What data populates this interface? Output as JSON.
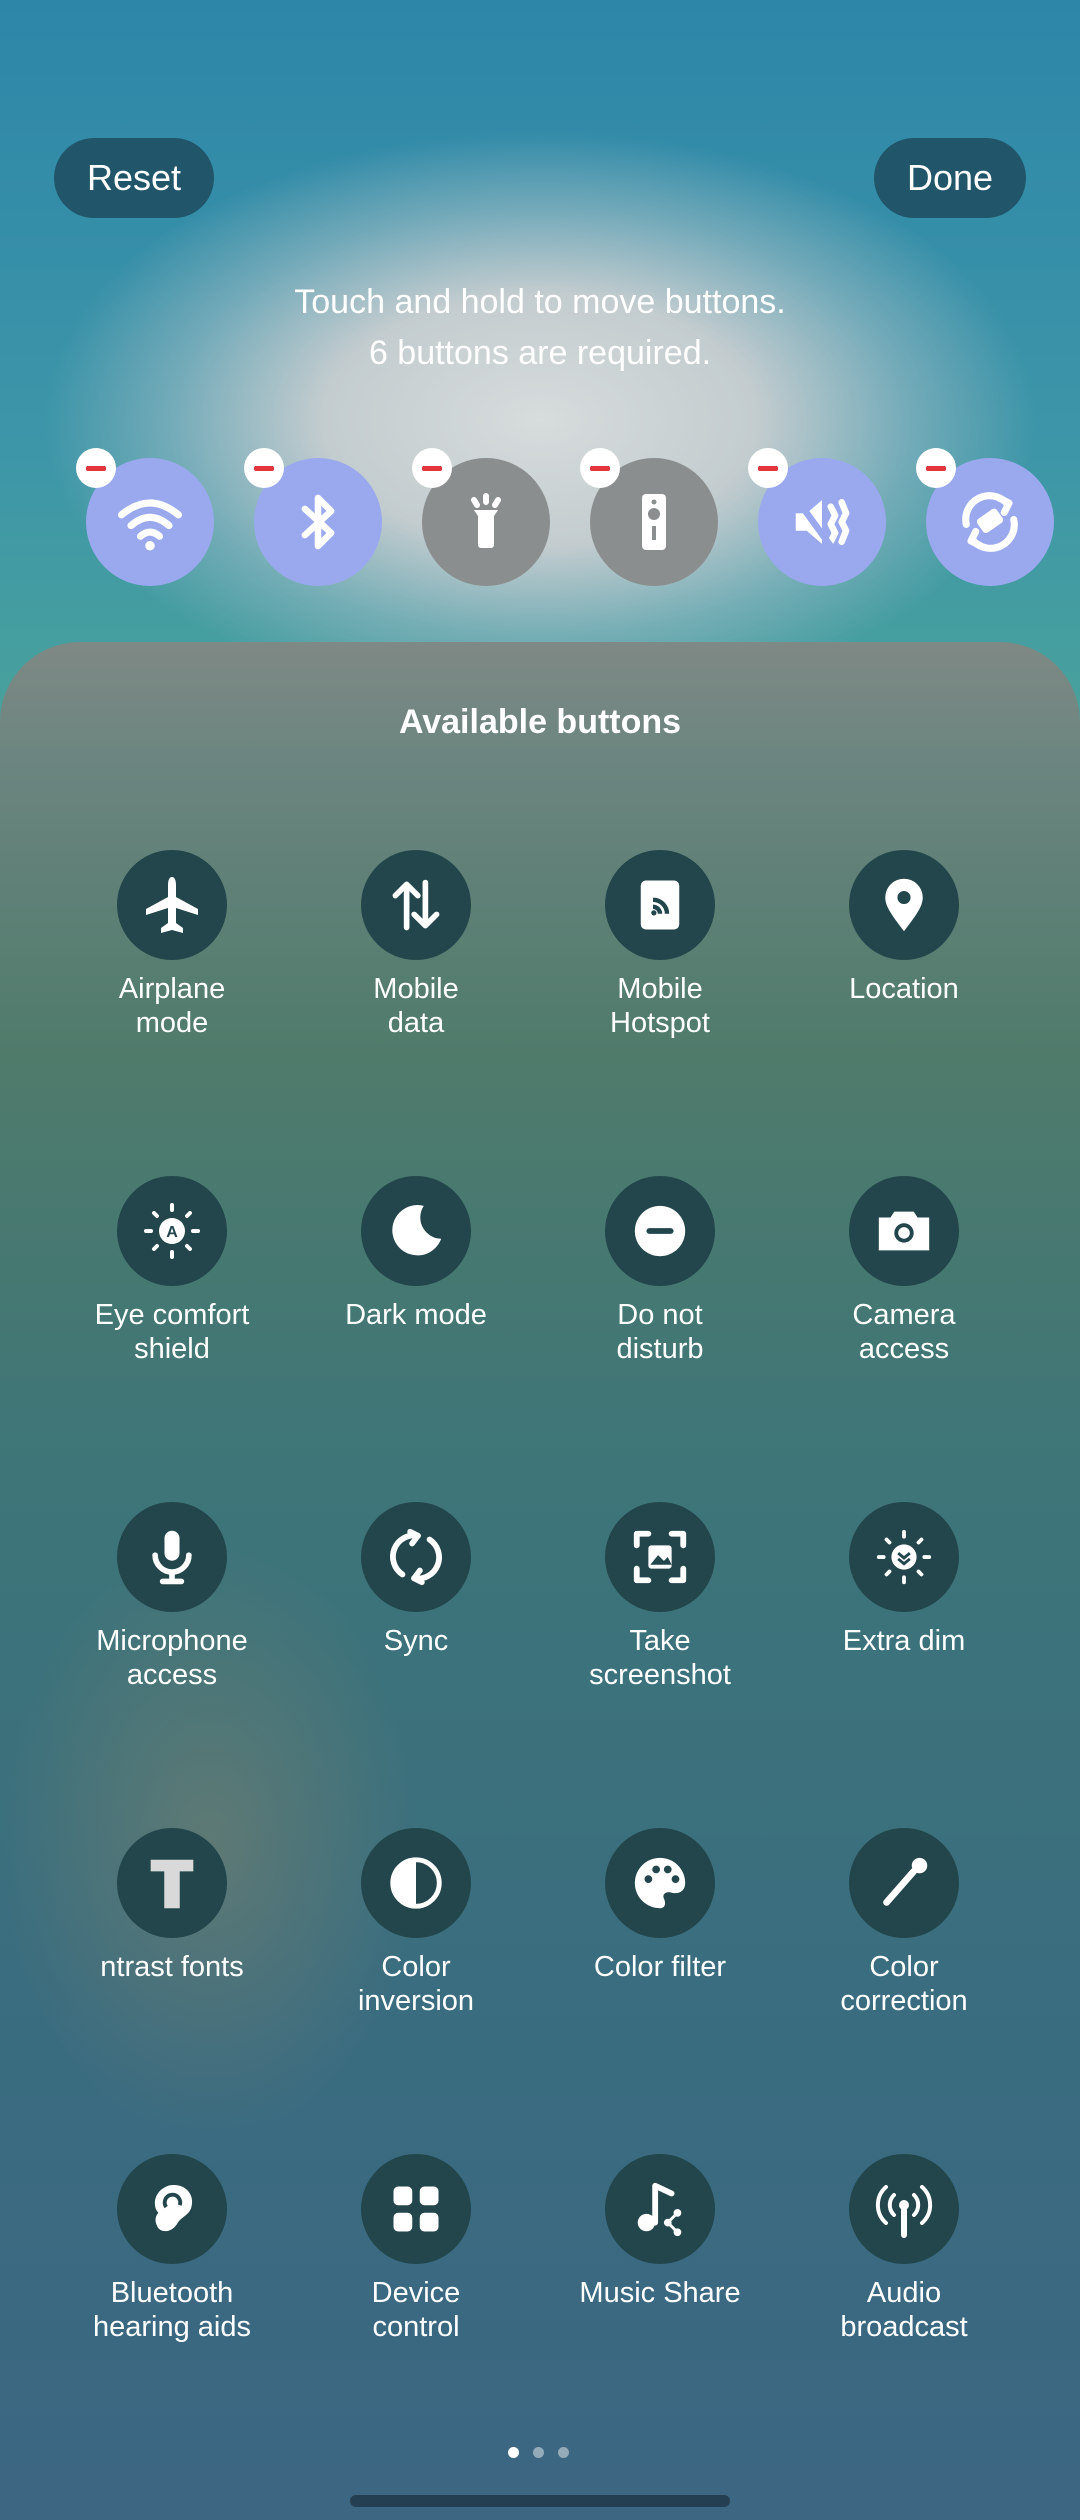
{
  "header": {
    "reset_label": "Reset",
    "done_label": "Done",
    "hint_line1": "Touch and hold to move buttons.",
    "hint_line2": "6 buttons are required."
  },
  "active_buttons": [
    {
      "icon": "wifi-icon",
      "state": "on"
    },
    {
      "icon": "bluetooth-icon",
      "state": "on"
    },
    {
      "icon": "flashlight-icon",
      "state": "off"
    },
    {
      "icon": "remote-icon",
      "state": "off"
    },
    {
      "icon": "sound-vibrate-icon",
      "state": "on"
    },
    {
      "icon": "auto-rotate-icon",
      "state": "on"
    }
  ],
  "panel": {
    "title": "Available buttons",
    "tiles": [
      {
        "label": "Airplane\nmode",
        "icon": "airplane-icon"
      },
      {
        "label": "Mobile\ndata",
        "icon": "mobile-data-icon"
      },
      {
        "label": "Mobile\nHotspot",
        "icon": "hotspot-icon"
      },
      {
        "label": "Location",
        "icon": "location-icon"
      },
      {
        "label": "Eye comfort\nshield",
        "icon": "eye-comfort-icon"
      },
      {
        "label": "Dark mode",
        "icon": "moon-icon"
      },
      {
        "label": "Do not\ndisturb",
        "icon": "do-not-disturb-icon"
      },
      {
        "label": "Camera\naccess",
        "icon": "camera-icon"
      },
      {
        "label": "Microphone\naccess",
        "icon": "microphone-icon"
      },
      {
        "label": "Sync",
        "icon": "sync-icon"
      },
      {
        "label": "Take\nscreenshot",
        "icon": "screenshot-icon"
      },
      {
        "label": "Extra dim",
        "icon": "extra-dim-icon"
      },
      {
        "label": "ntrast fonts",
        "icon": "text-icon"
      },
      {
        "label": "Color\ninversion",
        "icon": "color-inversion-icon"
      },
      {
        "label": "Color filter",
        "icon": "palette-icon"
      },
      {
        "label": "Color\ncorrection",
        "icon": "dropper-icon"
      },
      {
        "label": "Bluetooth\nhearing aids",
        "icon": "hearing-aid-icon"
      },
      {
        "label": "Device\ncontrol",
        "icon": "device-control-icon"
      },
      {
        "label": "Music Share",
        "icon": "music-share-icon"
      },
      {
        "label": "Audio\nbroadcast",
        "icon": "broadcast-icon"
      }
    ]
  },
  "pagination": {
    "pages": 3,
    "current": 1
  },
  "colors": {
    "active_on": "#9aa9ee",
    "active_off": "#8b8e8e",
    "tile_bg": "#22464b",
    "remove": "#e2343a"
  }
}
